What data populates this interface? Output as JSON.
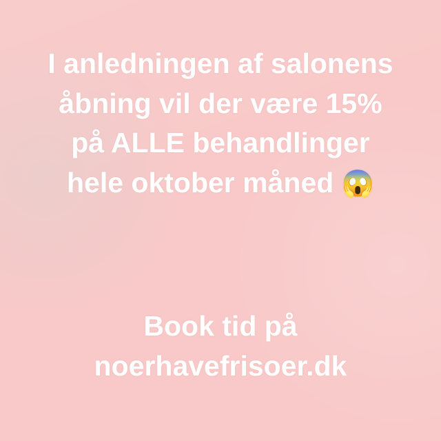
{
  "background_color": "#f8c9c8",
  "message": {
    "lines": [
      "I anledningen af salonens",
      "åbning vil der være 15%",
      "på ALLE behandlinger",
      "hele oktober måned"
    ],
    "emoji": "😱",
    "emoji_name": "face-screaming-in-fear"
  },
  "cta": {
    "lines": [
      "Book tid på",
      "noerhavefrisoer.dk"
    ]
  }
}
